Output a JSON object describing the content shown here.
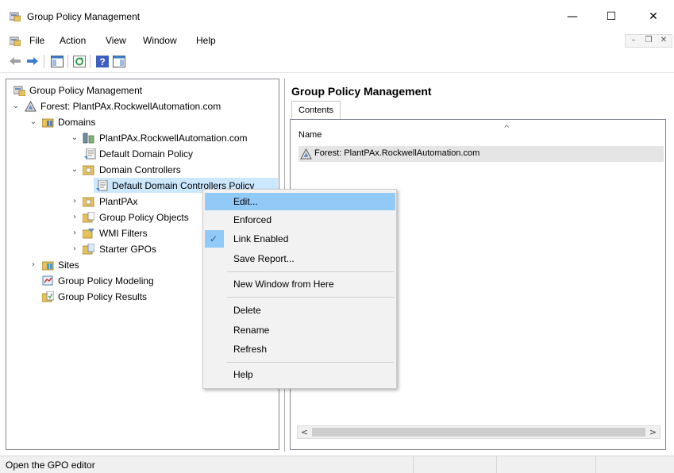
{
  "window": {
    "title": "Group Policy Management",
    "minimize_glyph": "—",
    "maximize_glyph": "☐",
    "close_glyph": "✕"
  },
  "menu": {
    "items": [
      "File",
      "Action",
      "View",
      "Window",
      "Help"
    ],
    "mdi_minimize": "–",
    "mdi_restore": "❐",
    "mdi_close": "✕"
  },
  "toolbar": {
    "icons": [
      "back-arrow-icon",
      "forward-arrow-icon",
      "show-hide-tree-icon",
      "refresh-icon",
      "help-icon",
      "properties-icon"
    ]
  },
  "tree": {
    "nodes": [
      {
        "label": "Group Policy Management",
        "icon": "gpm-console-icon",
        "expander": ""
      },
      {
        "label": "Forest: PlantPAx.RockwellAutomation.com",
        "icon": "forest-icon",
        "expander": "⌄"
      },
      {
        "label": "Domains",
        "icon": "domains-folder-icon",
        "expander": "⌄"
      },
      {
        "label": "PlantPAx.RockwellAutomation.com",
        "icon": "domain-icon",
        "expander": "⌄"
      },
      {
        "label": "Default Domain Policy",
        "icon": "gpo-link-icon",
        "expander": ""
      },
      {
        "label": "Domain Controllers",
        "icon": "ou-folder-icon",
        "expander": "⌄"
      },
      {
        "label": "Default Domain Controllers Policy",
        "icon": "gpo-link-icon",
        "expander": ""
      },
      {
        "label": "PlantPAx",
        "icon": "ou-folder-icon",
        "expander": "›"
      },
      {
        "label": "Group Policy Objects",
        "icon": "gpo-folder-icon",
        "expander": "›"
      },
      {
        "label": "WMI Filters",
        "icon": "wmi-folder-icon",
        "expander": "›"
      },
      {
        "label": "Starter GPOs",
        "icon": "starter-gpo-folder-icon",
        "expander": "›"
      },
      {
        "label": "Sites",
        "icon": "sites-folder-icon",
        "expander": "›"
      },
      {
        "label": "Group Policy Modeling",
        "icon": "modeling-icon",
        "expander": ""
      },
      {
        "label": "Group Policy Results",
        "icon": "results-icon",
        "expander": ""
      }
    ]
  },
  "right_pane": {
    "header": "Group Policy Management",
    "tab": "Contents",
    "column_name": "Name",
    "sort_caret": "^",
    "rows": [
      "Forest: PlantPAx.RockwellAutomation.com"
    ],
    "scroll_left": "<",
    "scroll_right": ">"
  },
  "context_menu": {
    "items": [
      {
        "label": "Edit...",
        "hover": true
      },
      {
        "label": "Enforced"
      },
      {
        "label": "Link Enabled",
        "checked": true
      },
      {
        "label": "Save Report..."
      },
      {
        "label": "New Window from Here"
      },
      {
        "label": "Delete"
      },
      {
        "label": "Rename"
      },
      {
        "label": "Refresh"
      },
      {
        "label": "Help"
      }
    ],
    "check_glyph": "✓"
  },
  "status": {
    "text": "Open the GPO editor"
  },
  "colors": {
    "selection": "#cce8ff",
    "menu_hover": "#91c9f7",
    "menu_bg": "#f2f2f2",
    "folder_yellow": "#e8c25a",
    "status_bg": "#f0f0f0"
  }
}
